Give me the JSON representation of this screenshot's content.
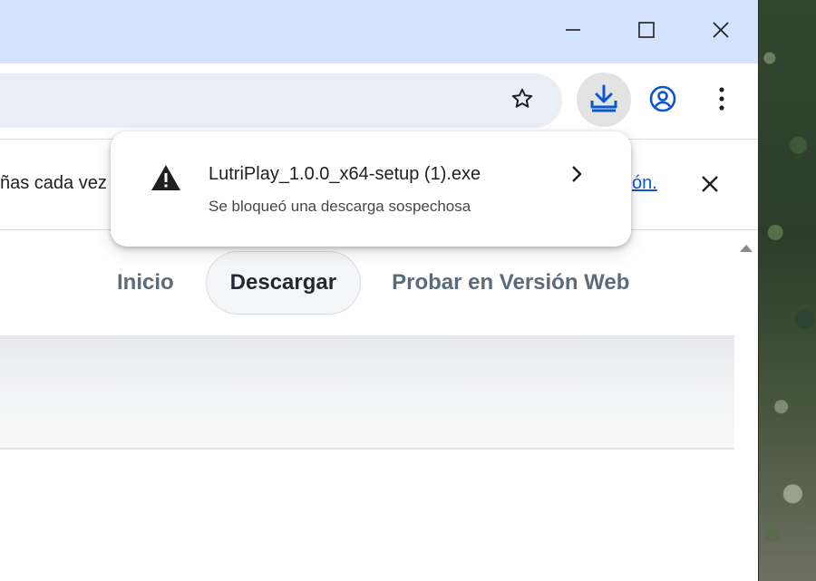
{
  "window": {
    "minimize_icon": "minimize-icon",
    "maximize_icon": "maximize-icon",
    "close_icon": "close-icon"
  },
  "toolbar": {
    "bookmark_icon": "star-icon",
    "download_icon": "download-icon",
    "profile_icon": "profile-icon",
    "menu_icon": "kebab-menu-icon"
  },
  "infobar": {
    "text": "ñas cada vez",
    "link": "ón."
  },
  "download_popup": {
    "filename": "LutriPlay_1.0.0_x64-setup (1).exe",
    "status": "Se bloqueó una descarga sospechosa",
    "warning_icon": "warning-icon",
    "chevron_icon": "chevron-right-icon"
  },
  "site_nav": {
    "items": [
      "Inicio",
      "Descargar",
      "Probar en Versión Web"
    ]
  },
  "colors": {
    "titlebar": "#d3e3fd",
    "omnibox": "#e9eef6",
    "accent": "#0b57d0"
  }
}
